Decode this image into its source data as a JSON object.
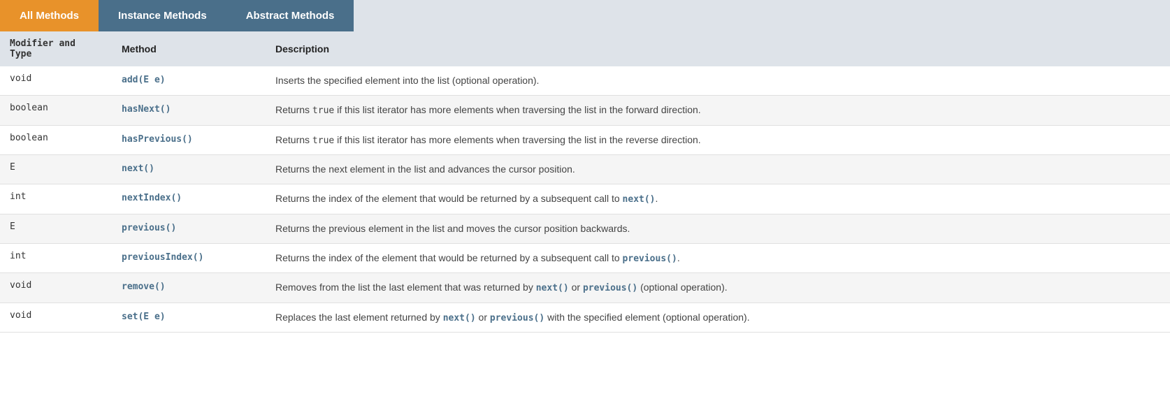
{
  "tabs": [
    {
      "id": "all",
      "label": "All Methods",
      "active": true
    },
    {
      "id": "instance",
      "label": "Instance Methods",
      "active": false
    },
    {
      "id": "abstract",
      "label": "Abstract Methods",
      "active": false
    }
  ],
  "table": {
    "headers": [
      "Modifier and Type",
      "Method",
      "Description"
    ],
    "rows": [
      {
        "modifier": "void",
        "method": "add(E e)",
        "description_plain": "Inserts the specified element into the list (optional operation).",
        "description_html": "Inserts the specified element into the list (optional operation)."
      },
      {
        "modifier": "boolean",
        "method": "hasNext()",
        "description_plain": "Returns true if this list iterator has more elements when traversing the list in the forward direction.",
        "description_html": "Returns <code>true</code> if this list iterator has more elements when traversing the list in the forward direction.",
        "inline_code": "true"
      },
      {
        "modifier": "boolean",
        "method": "hasPrevious()",
        "description_plain": "Returns true if this list iterator has more elements when traversing the list in the reverse direction.",
        "description_html": "Returns <code>true</code> if this list iterator has more elements when traversing the list in the reverse direction.",
        "inline_code": "true"
      },
      {
        "modifier": "E",
        "method": "next()",
        "description_plain": "Returns the next element in the list and advances the cursor position.",
        "description_html": "Returns the next element in the list and advances the cursor position."
      },
      {
        "modifier": "int",
        "method": "nextIndex()",
        "description_plain": "Returns the index of the element that would be returned by a subsequent call to next().",
        "description_html": "Returns the index of the element that would be returned by a subsequent call to <strong>next()</strong>.",
        "ref_method": "next()"
      },
      {
        "modifier": "E",
        "method": "previous()",
        "description_plain": "Returns the previous element in the list and moves the cursor position backwards.",
        "description_html": "Returns the previous element in the list and moves the cursor position backwards."
      },
      {
        "modifier": "int",
        "method": "previousIndex()",
        "description_plain": "Returns the index of the element that would be returned by a subsequent call to previous().",
        "description_html": "Returns the index of the element that would be returned by a subsequent call to <strong>previous()</strong>.",
        "ref_method": "previous()"
      },
      {
        "modifier": "void",
        "method": "remove()",
        "description_plain": "Removes from the list the last element that was returned by next() or previous() (optional operation).",
        "description_html": "Removes from the list the last element that was returned by <strong>next()</strong> or <strong>previous()</strong> (optional operation).",
        "ref_methods": [
          "next()",
          "previous()"
        ]
      },
      {
        "modifier": "void",
        "method": "set(E e)",
        "description_plain": "Replaces the last element returned by next() or previous() with the specified element (optional operation).",
        "description_html": "Replaces the last element returned by <strong>next()</strong> or <strong>previous()</strong> with the specified element (optional operation).",
        "ref_methods": [
          "next()",
          "previous()"
        ]
      }
    ]
  }
}
